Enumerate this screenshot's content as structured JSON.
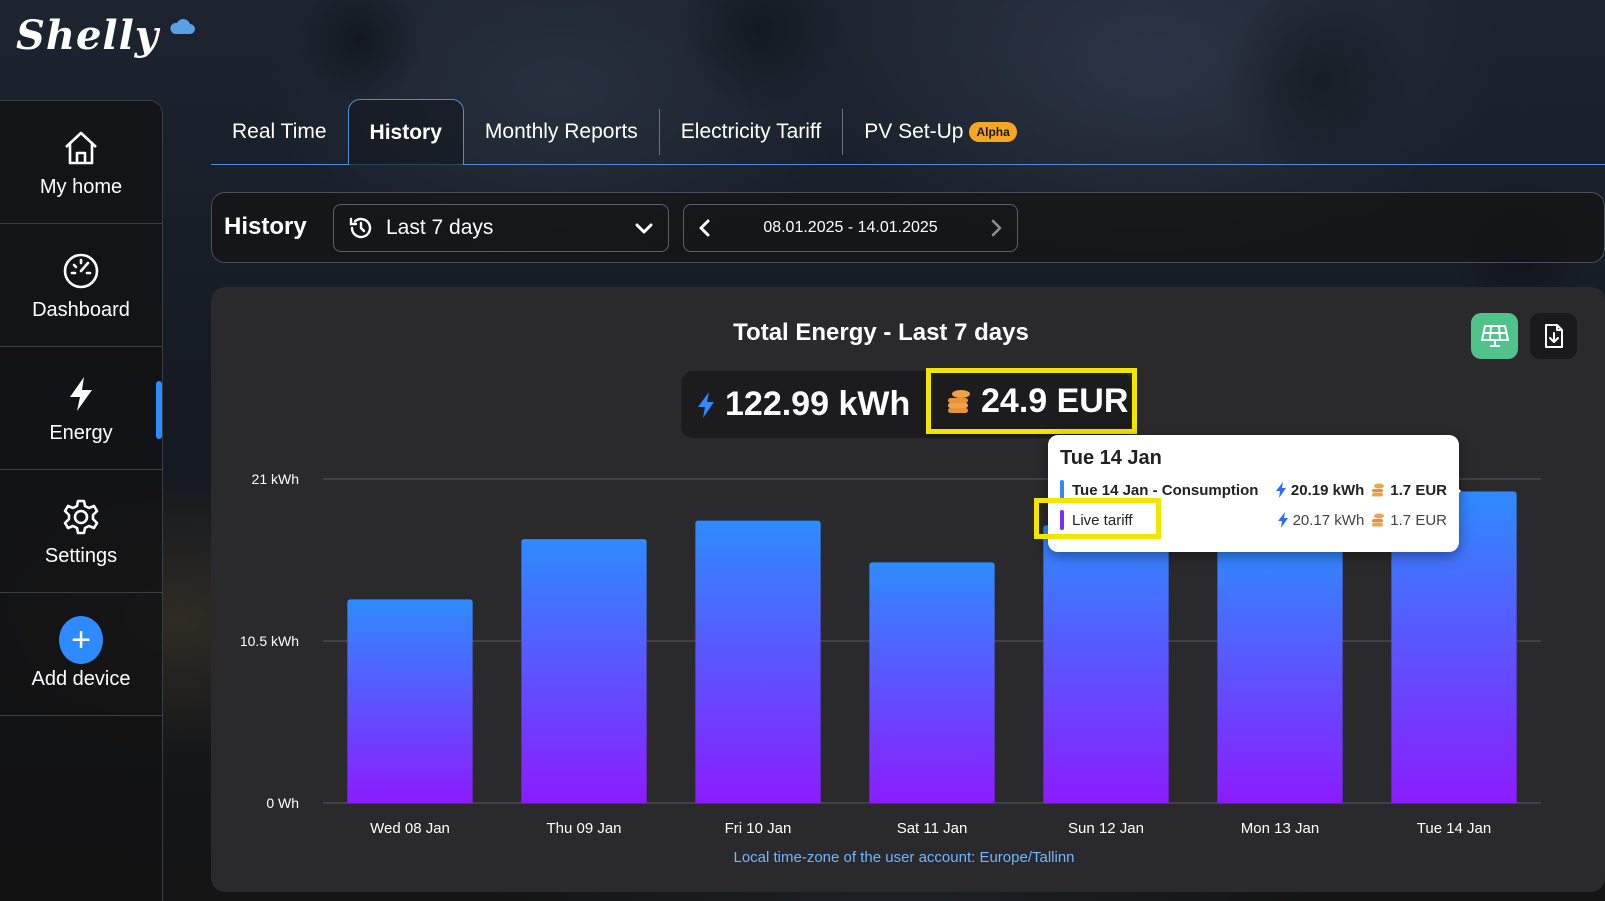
{
  "brand": {
    "logo_text": "Shelly"
  },
  "sidebar": {
    "items": [
      {
        "label": "My home",
        "icon": "home-icon"
      },
      {
        "label": "Dashboard",
        "icon": "gauge-icon"
      },
      {
        "label": "Energy",
        "icon": "lightning-icon",
        "active": true
      },
      {
        "label": "Settings",
        "icon": "gear-icon"
      },
      {
        "label": "Add device",
        "icon": "plus-icon"
      }
    ]
  },
  "tabs": [
    {
      "label": "Real Time"
    },
    {
      "label": "History",
      "active": true
    },
    {
      "label": "Monthly Reports"
    },
    {
      "label": "Electricity Tariff"
    },
    {
      "label": "PV Set-Up",
      "badge": "Alpha"
    }
  ],
  "history_bar": {
    "title": "History",
    "range_select": "Last 7 days",
    "date_range": "08.01.2025 - 14.01.2025"
  },
  "chart_card": {
    "title": "Total Energy - Last 7 days",
    "total_energy": "122.99 kWh",
    "total_cost": "24.9 EUR",
    "footnote": "Local time-zone of the user account: Europe/Tallinn"
  },
  "tooltip": {
    "title": "Tue 14 Jan",
    "rows": [
      {
        "label": "Tue 14 Jan - Consumption",
        "energy": "20.19 kWh",
        "cost": "1.7 EUR",
        "color": "#2e8bff"
      },
      {
        "label": "Live tariff",
        "energy": "20.17 kWh",
        "cost": "1.7 EUR",
        "color": "#7c2cff"
      }
    ]
  },
  "colors": {
    "accent": "#2e8bff",
    "bar_top": "#2e8bff",
    "bar_bottom": "#8b1cff",
    "highlight": "#f2e600",
    "pv_button": "#4fc38a"
  },
  "chart_data": {
    "type": "bar",
    "categories": [
      "Wed 08 Jan",
      "Thu 09 Jan",
      "Fri 10 Jan",
      "Sat 11 Jan",
      "Sun 12 Jan",
      "Mon 13 Jan",
      "Tue 14 Jan"
    ],
    "values": [
      13.2,
      17.1,
      18.3,
      15.6,
      18.0,
      17.0,
      20.19
    ],
    "y_ticks": [
      "0 Wh",
      "10.5 kWh",
      "21 kWh"
    ],
    "ylim": [
      0,
      21
    ],
    "unit": "kWh",
    "grid": true
  }
}
